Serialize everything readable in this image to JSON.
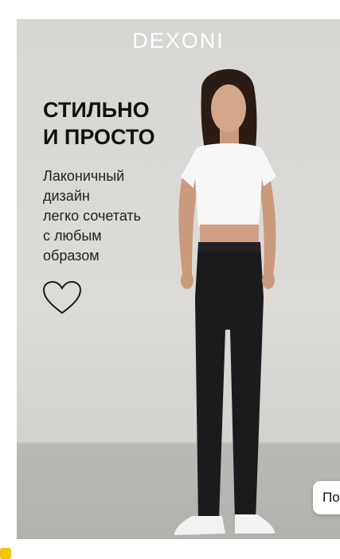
{
  "banner": {
    "brand": "DEXONI",
    "headline_line1": "СТИЛЬНО",
    "headline_line2": "И ПРОСТО",
    "body_line1": "Лаконичный",
    "body_line2": "дизайн",
    "body_line3": "легко сочетать",
    "body_line4": "с любым",
    "body_line5": "образом",
    "favorite_icon": "heart-outline-icon"
  },
  "side_button": {
    "label": "По"
  },
  "colors": {
    "headline": "#111111",
    "brand": "#ffffff",
    "background": "#d8d6d3",
    "badge": "#f5c400"
  }
}
